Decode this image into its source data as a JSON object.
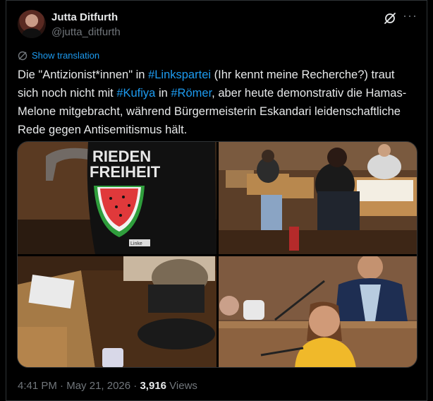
{
  "author": {
    "name": "Jutta Ditfurth",
    "handle": "@jutta_ditfurth"
  },
  "header": {
    "grok_icon": "grok-icon",
    "more_icon": "more-dots-icon"
  },
  "translation": {
    "icon": "globe-icon",
    "label": "Show translation"
  },
  "tweet": {
    "seg1": "Die \"Antizionist*innen\" in ",
    "tag1": "#Linkspartei",
    "seg2": " (Ihr kennt meine Recherche?) traut sich noch nicht mit ",
    "tag2": "#Kufiya",
    "seg3": " in ",
    "tag3": "#Römer",
    "seg4": ", aber heute demonstrativ die Hamas-Melone mitgebracht, während Bürgermeisterin Eskandari leidenschaftliche Rede gegen Antisemitismus hält."
  },
  "media": {
    "image1_text_line1": "RIEDEN",
    "image1_text_line2": "FREIHEIT",
    "image1_small_text": "Linke"
  },
  "footer": {
    "time": "4:41 PM",
    "separator": " · ",
    "date": "May 21, 2026",
    "views_count": "3,916",
    "views_label": " Views"
  },
  "colors": {
    "accent": "#1d9bf0",
    "text": "#e7e9ea",
    "muted": "#71767b",
    "border": "#2f3336"
  }
}
